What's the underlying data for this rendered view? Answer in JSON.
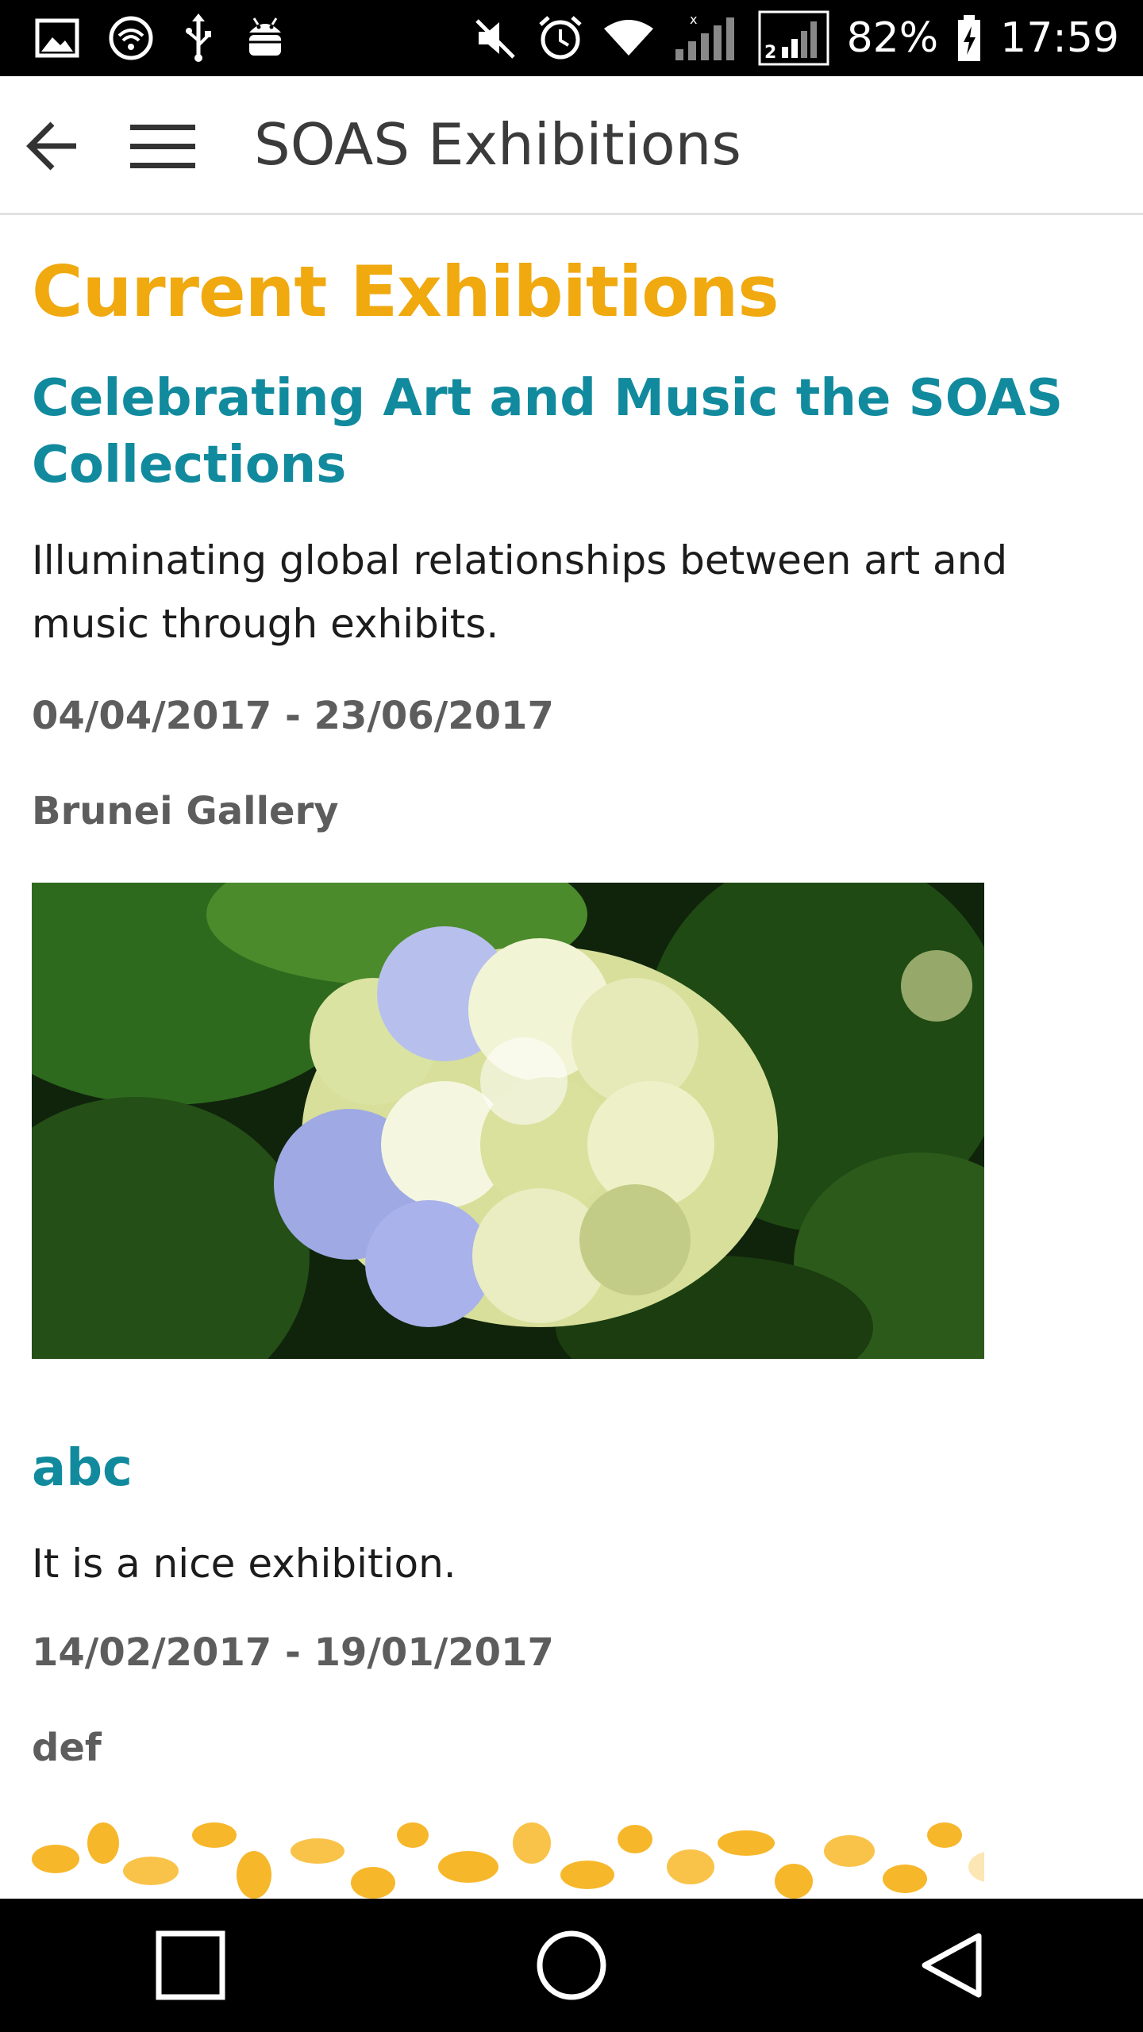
{
  "status_bar": {
    "battery_percent": "82%",
    "time": "17:59",
    "icons": [
      "image-icon",
      "wifi-hotspot-icon",
      "usb-icon",
      "android-debug-icon",
      "mute-icon",
      "alarm-icon",
      "wifi-icon",
      "signal-1-icon",
      "signal-2-icon",
      "battery-icon"
    ]
  },
  "app_bar": {
    "title": "SOAS Exhibitions",
    "icons": [
      "back-arrow-icon",
      "hamburger-menu-icon"
    ]
  },
  "page": {
    "heading": "Current Exhibitions",
    "exhibitions": [
      {
        "title": "Celebrating Art and Music the SOAS Collections",
        "description": "Illuminating global relationships between art and music through exhibits.",
        "dates": "04/04/2017 - 23/06/2017",
        "venue": "Brunei Gallery",
        "image": "hydrangea-photo"
      },
      {
        "title": "abc",
        "description": "It is a nice exhibition.",
        "dates": "14/02/2017 - 19/01/2017",
        "venue": "def",
        "image": "yellow-leaves-pattern"
      }
    ]
  },
  "nav_bar": {
    "icons": [
      "recent-apps-icon",
      "home-icon",
      "back-icon"
    ]
  },
  "colors": {
    "heading": "#f0a90f",
    "exhibition_title": "#118a9e",
    "meta_text": "#5d5d5d",
    "body_text": "#1c1c1c"
  }
}
